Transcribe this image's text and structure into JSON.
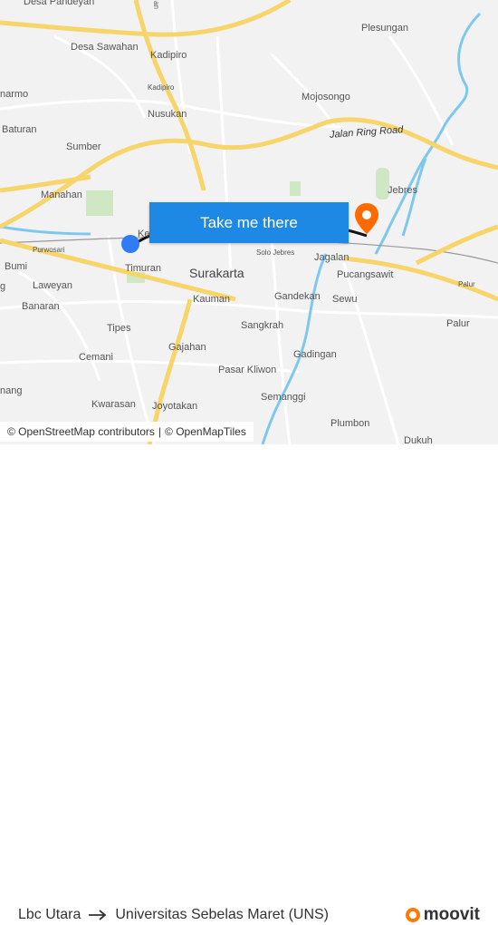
{
  "map": {
    "labels": [
      {
        "id": "desa-pandeyan",
        "text": "Desa Pandeyan"
      },
      {
        "id": "desa-sawahan",
        "text": "Desa Sawahan"
      },
      {
        "id": "kadipiro",
        "text": "Kadipiro"
      },
      {
        "id": "kadipiro-small",
        "text": "Kadipiro"
      },
      {
        "id": "nusukan",
        "text": "Nusukan"
      },
      {
        "id": "plesungan",
        "text": "Plesungan"
      },
      {
        "id": "mojosongo",
        "text": "Mojosongo"
      },
      {
        "id": "baturan",
        "text": "Baturan"
      },
      {
        "id": "sumber",
        "text": "Sumber"
      },
      {
        "id": "manahan",
        "text": "Manahan"
      },
      {
        "id": "jebres",
        "text": "Jebres"
      },
      {
        "id": "purwosari",
        "text": "Purwosari"
      },
      {
        "id": "timuran",
        "text": "Timuran"
      },
      {
        "id": "surakarta",
        "text": "Surakarta"
      },
      {
        "id": "solo-jebres",
        "text": "Solo Jebres"
      },
      {
        "id": "jagalan",
        "text": "Jagalan"
      },
      {
        "id": "pucangsawit",
        "text": "Pucangsawit"
      },
      {
        "id": "palur-small",
        "text": "Palur"
      },
      {
        "id": "bumi",
        "text": "Bumi"
      },
      {
        "id": "laweyan",
        "text": "Laweyan"
      },
      {
        "id": "banaran",
        "text": "Banaran"
      },
      {
        "id": "kauman",
        "text": "Kauman"
      },
      {
        "id": "gandekan",
        "text": "Gandekan"
      },
      {
        "id": "sewu",
        "text": "Sewu"
      },
      {
        "id": "tipes",
        "text": "Tipes"
      },
      {
        "id": "sangkrah",
        "text": "Sangkrah"
      },
      {
        "id": "palur",
        "text": "Palur"
      },
      {
        "id": "cemani",
        "text": "Cemani"
      },
      {
        "id": "gajahan",
        "text": "Gajahan"
      },
      {
        "id": "gadingan",
        "text": "Gadingan"
      },
      {
        "id": "pasar-kliwon",
        "text": "Pasar Kliwon"
      },
      {
        "id": "semanggi",
        "text": "Semanggi"
      },
      {
        "id": "kwarasan",
        "text": "Kwarasan"
      },
      {
        "id": "joyotakan",
        "text": "Joyotakan"
      },
      {
        "id": "plumbon",
        "text": "Plumbon"
      },
      {
        "id": "dukuh",
        "text": "Dukuh"
      },
      {
        "id": "jalan-ring-road",
        "text": "Jalan Ring Road"
      }
    ],
    "edge_labels": {
      "left1": "narmo",
      "left2": "g",
      "left3": "nang",
      "top1": "an",
      "ke": "Ke"
    },
    "cta_label": "Take me there",
    "attribution": {
      "osm": "© OpenStreetMap contributors",
      "sep": "|",
      "tiles": "© OpenMapTiles"
    }
  },
  "footer": {
    "origin": "Lbc Utara",
    "destination": "Universitas Sebelas Maret (UNS)",
    "brand": "moovit"
  },
  "colors": {
    "cta": "#1e88e5",
    "origin_dot": "#2f7df6",
    "destination_pin": "#ff6a00",
    "river": "#7ec8ef",
    "major_road": "#f7d56b",
    "brand": "#ff7a00"
  },
  "icons": {
    "origin": "origin-dot-icon",
    "destination": "destination-pin-icon",
    "arrow": "arrow-right-icon",
    "brand": "moovit-logo-icon"
  }
}
